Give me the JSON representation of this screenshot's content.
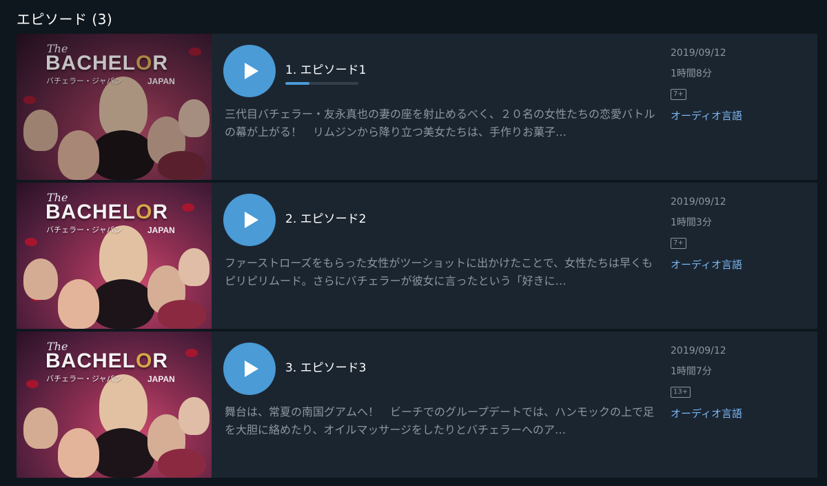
{
  "section": {
    "title": "エピソード (3)"
  },
  "thumbnail": {
    "the": "The",
    "logo_left": "BACHEL",
    "logo_ring": "O",
    "logo_right": "R",
    "subtitle": "バチェラー・ジャパン",
    "japan": "JAPAN"
  },
  "episodes": [
    {
      "title": "1. エピソード1",
      "progress": 0.33,
      "synopsis": "三代目バチェラー・友永真也の妻の座を射止めるべく、２０名の女性たちの恋愛バトルの幕が上がる！　リムジンから降り立つ美女たちは、手作りお菓子…",
      "date": "2019/09/12",
      "duration": "1時間8分",
      "rating": "7+",
      "audio": "オーディオ言語"
    },
    {
      "title": "2. エピソード2",
      "synopsis": "ファーストローズをもらった女性がツーショットに出かけたことで、女性たちは早くもピリピリムード。さらにバチェラーが彼女に言ったという「好きに…",
      "date": "2019/09/12",
      "duration": "1時間3分",
      "rating": "7+",
      "audio": "オーディオ言語"
    },
    {
      "title": "3. エピソード3",
      "synopsis": "舞台は、常夏の南国グアムへ！　ビーチでのグループデートでは、ハンモックの上で足を大胆に絡めたり、オイルマッサージをしたりとバチェラーへのア…",
      "date": "2019/09/12",
      "duration": "1時間7分",
      "rating": "13+",
      "audio": "オーディオ言語"
    }
  ],
  "colors": {
    "background": "#0f171e",
    "row_background": "#1b2530",
    "accent": "#4a9bd6",
    "link": "#79b8f3",
    "muted_text": "#8d97a2"
  }
}
